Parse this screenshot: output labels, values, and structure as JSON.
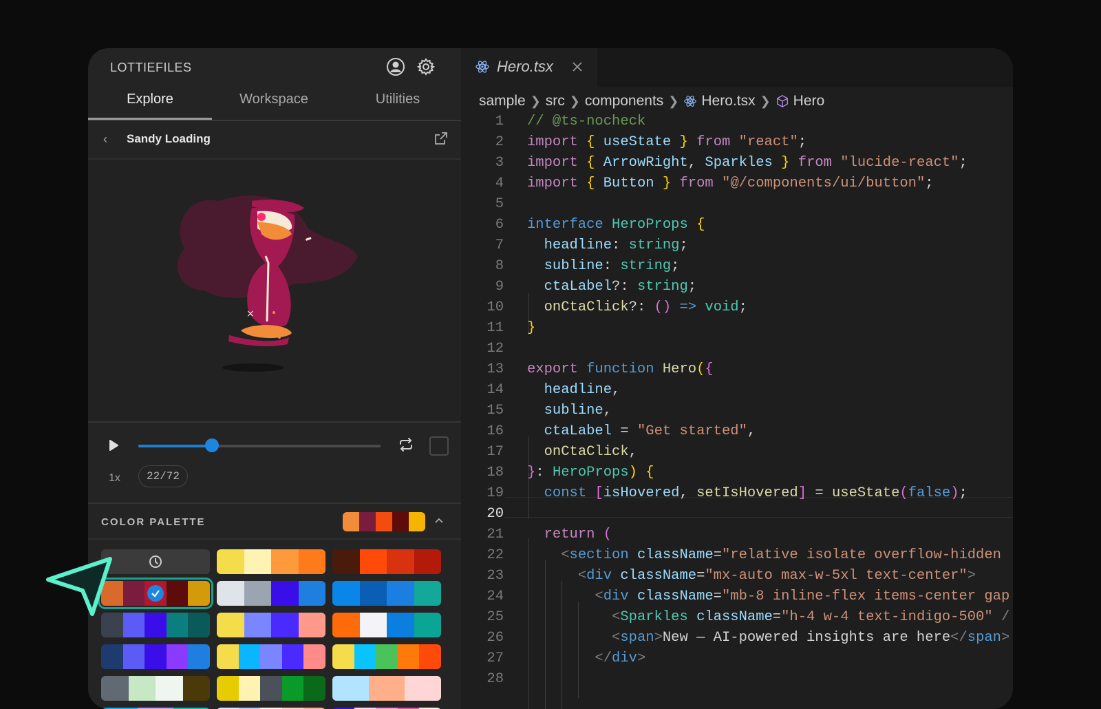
{
  "sidebar": {
    "brand": "LOTTIEFILES",
    "tabs": [
      {
        "label": "Explore"
      },
      {
        "label": "Workspace"
      },
      {
        "label": "Utilities"
      }
    ],
    "animation_title": "Sandy Loading",
    "player": {
      "speed": "1x",
      "frames": "22/72",
      "progress": 0.305
    },
    "palette": {
      "label": "COLOR PALETTE",
      "current": [
        "#f28c38",
        "#7a1c3e",
        "#f24c0f",
        "#5e0b0b",
        "#f5b400"
      ],
      "rows": [
        [
          null,
          [
            "#f5dc4a",
            "#fff3b3",
            "#ff9a3c",
            "#ff7a1a"
          ],
          [
            "#4a1a0a",
            "#ff4a0a",
            "#d9320f",
            "#b31a0a"
          ]
        ],
        [
          [
            "#d96a2c",
            "#7a1c3e",
            "#b0182f",
            "#5e0b0b",
            "#d39b0c"
          ],
          [
            "#dfe3ea",
            "#9aa5b1",
            "#3a0ee8",
            "#1e7fe0"
          ],
          [
            "#0a86e8",
            "#0a5fb5",
            "#1a7fe0",
            "#12a89a"
          ]
        ],
        [
          [
            "#3a4250",
            "#5b5cf6",
            "#3a0ee8",
            "#0b7f7f",
            "#0b5a5a"
          ],
          [
            "#f5dc4a",
            "#7a86ff",
            "#4a2aff",
            "#ff9a8a"
          ],
          [
            "#ff6a0a",
            "#f3f3f8",
            "#0a7fe0",
            "#0ba595"
          ]
        ],
        [
          [
            "#1e3a6e",
            "#5b5cf6",
            "#3a0ee8",
            "#8b3aff",
            "#1e7fe0"
          ],
          [
            "#f5dc4a",
            "#0ab6ff",
            "#7a86ff",
            "#4a2aff",
            "#ff8a8a"
          ],
          [
            "#f5dc4a",
            "#0ac4ff",
            "#4ac45a",
            "#ff7a0a",
            "#ff4a0a"
          ]
        ],
        [
          [
            "#616a72",
            "#c7e8c4",
            "#eef6ef",
            "#4a3a0a"
          ],
          [
            "#e6cc00",
            "#fff3b3",
            "#4a5158",
            "#0a9a2a",
            "#0a6a1a"
          ],
          [
            "#b3e4ff",
            "#ffb08a",
            "#ffd6d6"
          ]
        ],
        [
          [
            "#0ab0ff",
            "#c49aff",
            "#0ac4a8"
          ],
          [
            "#dce6ff",
            "#b7c8ff",
            "#fff3f0",
            "#ffcfb8",
            "#ffb08a"
          ],
          [
            "#3a0ee8",
            "#ffd6f0",
            "#ff8ad6",
            "#e04aa8",
            "#fff3e0"
          ]
        ]
      ]
    }
  },
  "editor": {
    "tab_name": "Hero.tsx",
    "breadcrumb": [
      "sample",
      "src",
      "components",
      "Hero.tsx",
      "Hero"
    ],
    "current_line": 20
  }
}
